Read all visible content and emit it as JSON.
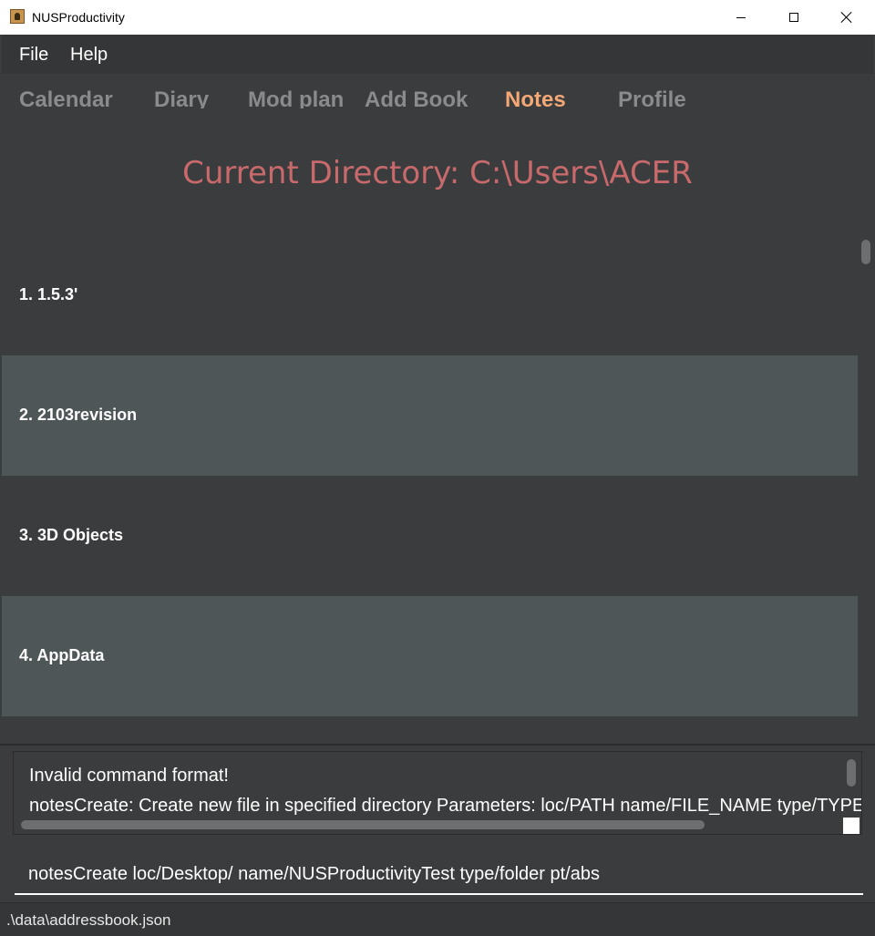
{
  "window": {
    "title": "NUSProductivity",
    "icon": "app-icon"
  },
  "menu": {
    "file": "File",
    "help": "Help"
  },
  "tabs": [
    {
      "label": "Calendar",
      "active": false
    },
    {
      "label": "Diary",
      "active": false
    },
    {
      "label": "Mod plan",
      "active": false
    },
    {
      "label": "Add Book",
      "active": false
    },
    {
      "label": "Notes",
      "active": true
    },
    {
      "label": "Profile",
      "active": false
    }
  ],
  "notes": {
    "current_directory": "Current Directory: C:\\Users\\ACER",
    "items": [
      "1.  1.5.3'",
      "2.  2103revision",
      "3.  3D Objects",
      "4.  AppData"
    ]
  },
  "result": {
    "line1": "Invalid command format!",
    "line2": "notesCreate: Create new file in specified directory Parameters: loc/PATH name/FILE_NAME type/TYPE"
  },
  "command": {
    "value": "notesCreate loc/Desktop/ name/NUSProductivityTest type/folder pt/abs"
  },
  "status": {
    "path": ".\\data\\addressbook.json"
  },
  "colors": {
    "background": "#3b3c3e",
    "active_tab": "#f3a876",
    "inactive_tab": "#8a8b8d",
    "directory_text": "#c86a6c",
    "alt_row": "#4f5658"
  }
}
